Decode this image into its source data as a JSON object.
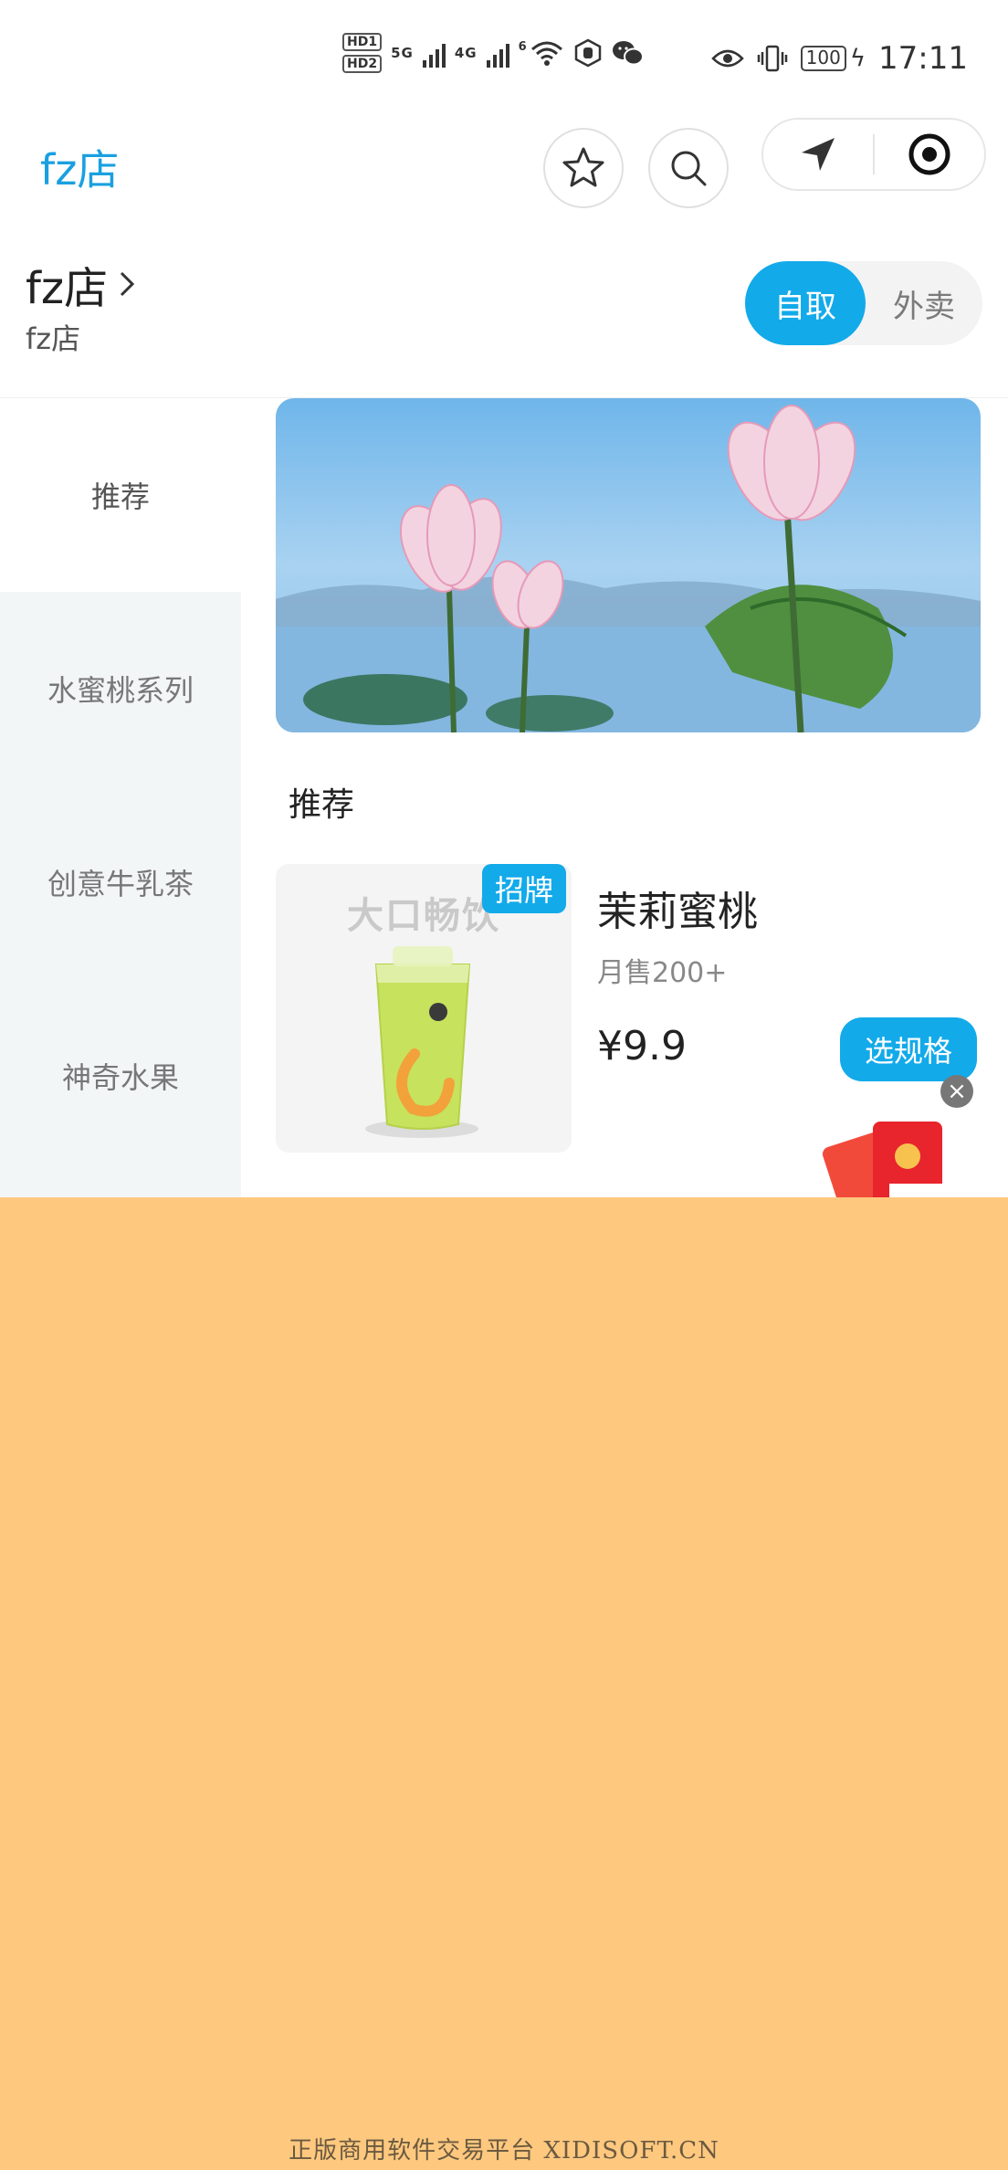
{
  "status_bar": {
    "hd1": "HD1",
    "hd2": "HD2",
    "net1": "5G",
    "net2": "4G",
    "wifi_badge": "6",
    "battery": "100",
    "time": "17:11"
  },
  "nav": {
    "title": "fz店",
    "icons": [
      "star-icon",
      "search-icon",
      "location-arrow-icon",
      "target-icon"
    ]
  },
  "store": {
    "name": "fz店",
    "subtitle": "fz店",
    "mode_pickup": "自取",
    "mode_delivery": "外卖",
    "accent_color": "#13aaea"
  },
  "sidebar": {
    "items": [
      {
        "label": "推荐",
        "active": true
      },
      {
        "label": "水蜜桃系列",
        "active": false
      },
      {
        "label": "创意牛乳茶",
        "active": false
      },
      {
        "label": "神奇水果",
        "active": false
      }
    ]
  },
  "content": {
    "section_title": "推荐",
    "product": {
      "image_watermark": "大口畅饮",
      "badge": "招牌",
      "name": "茉莉蜜桃",
      "sales": "月售200+",
      "price": "¥9.9",
      "button": "选规格"
    }
  },
  "overlay": {
    "color": "#fec87f",
    "footer_text": "正版商用软件交易平台 XIDISOFT.CN"
  }
}
